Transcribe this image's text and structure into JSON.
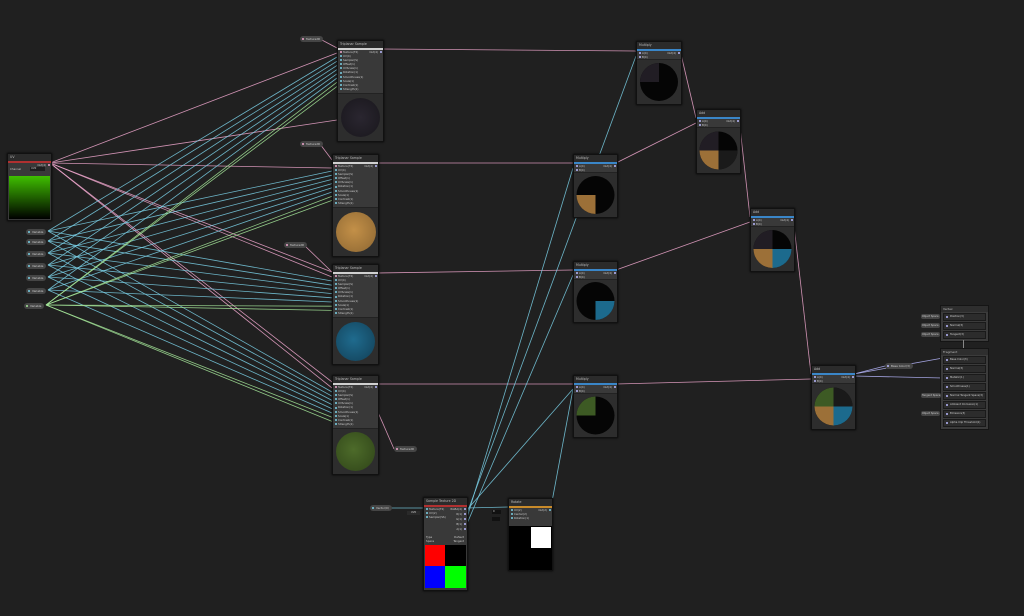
{
  "colors": {
    "background": "#202020",
    "wire_texture": "#7ad0e6",
    "wire_vector": "#a6e89a",
    "wire_color": "#f0a7ce",
    "wire_float": "#b9b9ff",
    "accent_blue": "#3a86c8",
    "accent_red": "#b03030",
    "accent_orange": "#c88a2a",
    "accent_white": "#d0d0d0"
  },
  "pills": {
    "tex_a": "Texture2D",
    "tex_b": "Texture2D",
    "tex_c": "Texture2D",
    "tex_d": "Texture2D",
    "uv0": "Variable",
    "uv1": "Variable",
    "uv2": "Variable",
    "uv3": "Variable",
    "uv4": "Variable",
    "uv5": "Variable",
    "uv6": "Variable",
    "split_in": "Vector(0)",
    "rotate_in": "Variable"
  },
  "sample_ports": [
    "Texture(T2)",
    "UV(4)",
    "Sampler(S)",
    "Offset(1)",
    "UVScale(1)",
    "Rotation(1)",
    "Smoothness(1)",
    "Scale(1)",
    "Contrast(1)",
    "Strength(1)"
  ],
  "nodes": {
    "uv_node": {
      "title": "UV",
      "out": "Out(4)",
      "field_label": "Channel",
      "field_value": "UV0"
    },
    "sample_a": {
      "title": "Triplanar Sample",
      "out": "Out(4)"
    },
    "sample_b": {
      "title": "Triplanar Sample",
      "out": "Out(4)"
    },
    "sample_c": {
      "title": "Triplanar Sample",
      "out": "Out(4)"
    },
    "sample_d": {
      "title": "Triplanar Sample",
      "out": "Out(4)"
    },
    "mul_a": {
      "title": "Multiply",
      "in_a": "A(4)",
      "in_b": "B(4)",
      "out": "Out(4)"
    },
    "mul_b": {
      "title": "Multiply",
      "in_a": "A(4)",
      "in_b": "B(4)",
      "out": "Out(4)"
    },
    "mul_c": {
      "title": "Multiply",
      "in_a": "A(4)",
      "in_b": "B(4)",
      "out": "Out(4)"
    },
    "mul_d": {
      "title": "Multiply",
      "in_a": "A(4)",
      "in_b": "B(4)",
      "out": "Out(4)"
    },
    "add_1": {
      "title": "Add",
      "in_a": "A(4)",
      "in_b": "B(4)",
      "out": "Out(4)"
    },
    "add_2": {
      "title": "Add",
      "in_a": "A(4)",
      "in_b": "B(4)",
      "out": "Out(4)"
    },
    "add_3": {
      "title": "Add",
      "in_a": "A(4)",
      "in_b": "B(4)",
      "out": "Out(4)"
    },
    "split_node": {
      "title": "Sample Texture 2D",
      "in_ports": [
        "Texture(T2)",
        "UV(2)",
        "Sampler(SS)"
      ],
      "out_ports": [
        "RGBA(4)",
        "R(1)",
        "G(1)",
        "B(1)",
        "A(1)"
      ],
      "type_label": "Type",
      "type_value": "Default",
      "space_label": "Space",
      "space_value": "Tangent",
      "field_value": "UV0"
    },
    "rotate_node": {
      "title": "Rotate",
      "in_ports": [
        "UV(2)",
        "Center(2)",
        "Rotation(1)"
      ],
      "out": "Out(2)",
      "field_value": "0"
    },
    "master": {
      "vertex_title": "Vertex",
      "vertex_rows": [
        {
          "label": "Object Space",
          "value": "Position(3)"
        },
        {
          "label": "Object Space",
          "value": "Normal(3)"
        },
        {
          "label": "Object Space",
          "value": "Tangent(3)"
        }
      ],
      "fragment_title": "Fragment",
      "fragment_rows": [
        {
          "label": "",
          "value": "Base Color(3)"
        },
        {
          "label": "",
          "value": "Normal(3)"
        },
        {
          "label": "",
          "value": "Metallic(1)"
        },
        {
          "label": "",
          "value": "Smoothness(1)"
        },
        {
          "label": "Tangent Space",
          "value": "Normal Tangent Space(3)"
        },
        {
          "label": "",
          "value": "Ambient Occlusion(1)"
        },
        {
          "label": "Object Space",
          "value": "Emission(3)"
        },
        {
          "label": "",
          "value": "Alpha Clip Threshold(1)"
        }
      ],
      "pill_in": "Base Color(3)"
    }
  }
}
